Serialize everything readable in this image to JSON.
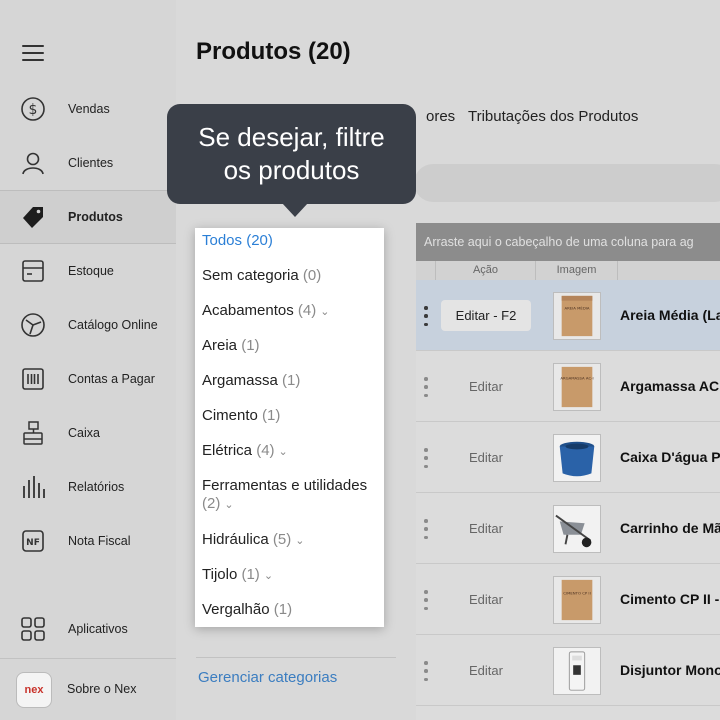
{
  "sidebar": {
    "items": [
      {
        "label": "Vendas",
        "icon": "dollar-icon"
      },
      {
        "label": "Clientes",
        "icon": "user-icon"
      },
      {
        "label": "Produtos",
        "icon": "tag-icon"
      },
      {
        "label": "Estoque",
        "icon": "box-icon"
      },
      {
        "label": "Catálogo Online",
        "icon": "catalog-icon"
      },
      {
        "label": "Contas a Pagar",
        "icon": "barcode-icon"
      },
      {
        "label": "Caixa",
        "icon": "register-icon"
      },
      {
        "label": "Relatórios",
        "icon": "bar-chart-icon"
      },
      {
        "label": "Nota Fiscal",
        "icon": "nf-icon"
      }
    ],
    "active_item": "Produtos",
    "aplicativos_label": "Aplicativos",
    "sobre_label": "Sobre o Nex",
    "nex_logo_text": "nex"
  },
  "main": {
    "title": "Produtos (20)",
    "tab_fragment": "ores",
    "tab_tributacoes": "Tributações dos Produtos",
    "group_bar_text": "Arraste aqui o cabeçalho de uma coluna para ag",
    "columns": {
      "acao": "Ação",
      "imagem": "Imagem"
    },
    "rows": [
      {
        "edit": "Editar - F2",
        "name": "Areia Média (La",
        "thumb_text": "AREIA MÉDIA"
      },
      {
        "edit": "Editar",
        "name": "Argamassa AC",
        "thumb_text": "ARGAMASSA AC-I"
      },
      {
        "edit": "Editar",
        "name": "Caixa D'água P",
        "thumb_text": ""
      },
      {
        "edit": "Editar",
        "name": "Carrinho de Mã",
        "thumb_text": ""
      },
      {
        "edit": "Editar",
        "name": "Cimento CP II -",
        "thumb_text": "CIMENTO CP II"
      },
      {
        "edit": "Editar",
        "name": "Disjuntor Mono",
        "thumb_text": ""
      }
    ]
  },
  "categories": {
    "items": [
      {
        "name": "Todos",
        "count": "(20)",
        "chevron": false
      },
      {
        "name": "Sem categoria",
        "count": "(0)",
        "chevron": false
      },
      {
        "name": "Acabamentos",
        "count": "(4)",
        "chevron": true
      },
      {
        "name": "Areia",
        "count": "(1)",
        "chevron": false
      },
      {
        "name": "Argamassa",
        "count": "(1)",
        "chevron": false
      },
      {
        "name": "Cimento",
        "count": "(1)",
        "chevron": false
      },
      {
        "name": "Elétrica",
        "count": "(4)",
        "chevron": true
      },
      {
        "name": "Ferramentas e utilidades",
        "count": "(2)",
        "chevron": true
      },
      {
        "name": "Hidráulica",
        "count": "(5)",
        "chevron": true
      },
      {
        "name": "Tijolo",
        "count": "(1)",
        "chevron": true
      },
      {
        "name": "Vergalhão",
        "count": "(1)",
        "chevron": false
      }
    ],
    "manage_link": "Gerenciar categorias"
  },
  "tooltip": {
    "line1": "Se desejar, filtre",
    "line2": "os produtos"
  },
  "colors": {
    "tooltip_bg": "#3a3f48",
    "selected_category": "#2b7fd6",
    "link": "#3b7dc0",
    "brand_red": "#c8322a"
  }
}
